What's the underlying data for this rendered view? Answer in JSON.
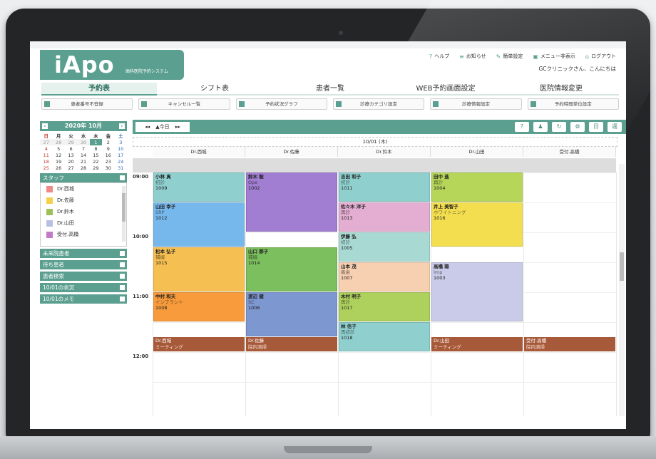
{
  "app": {
    "logo": "iApo",
    "subtitle": "歯科医院予約システム",
    "greeting": "GCクリニックさん、こんにちは"
  },
  "top_links": [
    {
      "icon": "?",
      "label": "ヘルプ"
    },
    {
      "icon": "≡",
      "label": "お知らせ"
    },
    {
      "icon": "✎",
      "label": "簡単設定"
    },
    {
      "icon": "▣",
      "label": "メニュー非表示"
    },
    {
      "icon": "⌂",
      "label": "ログアウト"
    }
  ],
  "main_tabs": [
    "予約表",
    "シフト表",
    "患者一覧",
    "WEB予約画面設定",
    "医院情報変更"
  ],
  "sub_buttons": [
    "患者番号不登録",
    "キャンセル一覧",
    "予約状況グラフ",
    "診療カテゴリ設定",
    "診療情報設定",
    "予約時間単位設定"
  ],
  "calendar": {
    "title": "2020年 10月",
    "weekdays": [
      "日",
      "月",
      "火",
      "水",
      "木",
      "金",
      "土"
    ],
    "weeks": [
      [
        "27",
        "28",
        "29",
        "30",
        "1",
        "2",
        "3"
      ],
      [
        "4",
        "5",
        "6",
        "7",
        "8",
        "9",
        "10"
      ],
      [
        "11",
        "12",
        "13",
        "14",
        "15",
        "16",
        "17"
      ],
      [
        "18",
        "19",
        "20",
        "21",
        "22",
        "23",
        "24"
      ],
      [
        "25",
        "26",
        "27",
        "28",
        "29",
        "30",
        "31"
      ]
    ]
  },
  "staff_panel": {
    "title": "スタッフ",
    "items": [
      {
        "name": "Dr.西城",
        "color": "#ee8a88"
      },
      {
        "name": "Dr.佐藤",
        "color": "#f3d24a"
      },
      {
        "name": "Dr.鈴木",
        "color": "#9cc15a"
      },
      {
        "name": "Dr.山田",
        "color": "#b7bfe6"
      },
      {
        "name": "受付.高橋",
        "color": "#c37ac7"
      }
    ]
  },
  "side_panels": [
    "未来院患者",
    "待ち患者",
    "患者検索",
    "10/01の状況",
    "10/01のメモ"
  ],
  "toolbar": {
    "prev": "◂◂",
    "today": "▲今日",
    "next": "▸▸",
    "day": "日",
    "week": "週"
  },
  "schedule": {
    "date": "10/01 (木)",
    "columns": [
      "Dr.西城",
      "Dr.佐藤",
      "Dr.鈴木",
      "Dr.山田",
      "受付.高橋"
    ],
    "times": [
      "09:00",
      "10:00",
      "11:00",
      "12:00"
    ],
    "appointments": [
      {
        "col": 0,
        "start": 0,
        "dur": 0.5,
        "name": "小林 真",
        "type": "初診",
        "id": "1009",
        "color": "#8fd0cf"
      },
      {
        "col": 0,
        "start": 0.5,
        "dur": 0.75,
        "name": "山田 幸子",
        "type": "SRP",
        "id": "1012",
        "color": "#76b7ec"
      },
      {
        "col": 0,
        "start": 1.25,
        "dur": 0.75,
        "name": "松本 弘子",
        "type": "補綴",
        "id": "1015",
        "color": "#f5bf52"
      },
      {
        "col": 0,
        "start": 2.0,
        "dur": 0.5,
        "name": "中村 和夫",
        "type": "インプラント",
        "id": "1008",
        "color": "#f79b3c"
      },
      {
        "col": 1,
        "start": 0,
        "dur": 1.0,
        "name": "鈴木 聡",
        "type": "Ope",
        "id": "1002",
        "color": "#a17ed1"
      },
      {
        "col": 1,
        "start": 1.25,
        "dur": 0.75,
        "name": "山口 節子",
        "type": "補綴",
        "id": "1014",
        "color": "#7cbf5e"
      },
      {
        "col": 1,
        "start": 2.0,
        "dur": 0.75,
        "name": "渡辺 健",
        "type": "SC",
        "id": "1006",
        "color": "#7d97d0"
      },
      {
        "col": 2,
        "start": 0,
        "dur": 0.5,
        "name": "吉田 和子",
        "type": "初診",
        "id": "1011",
        "color": "#8fd0cf"
      },
      {
        "col": 2,
        "start": 0.5,
        "dur": 0.5,
        "name": "佐々木 洋子",
        "type": "再診",
        "id": "1013",
        "color": "#e3aed1"
      },
      {
        "col": 2,
        "start": 1.0,
        "dur": 0.5,
        "name": "伊藤 弘",
        "type": "初診",
        "id": "1005",
        "color": "#a8d9d3"
      },
      {
        "col": 2,
        "start": 1.5,
        "dur": 0.5,
        "name": "山本 茂",
        "type": "義歯",
        "id": "1007",
        "color": "#f7cfb1"
      },
      {
        "col": 2,
        "start": 2.0,
        "dur": 0.5,
        "name": "木村 明子",
        "type": "再診",
        "id": "1017",
        "color": "#aed05d"
      },
      {
        "col": 2,
        "start": 2.5,
        "dur": 0.5,
        "name": "林 信子",
        "type": "再初診",
        "id": "1018",
        "color": "#8fd0cf"
      },
      {
        "col": 3,
        "start": 0,
        "dur": 0.5,
        "name": "田中 進",
        "type": "再診",
        "id": "1004",
        "color": "#b6d65a"
      },
      {
        "col": 3,
        "start": 0.5,
        "dur": 0.75,
        "name": "井上 美智子",
        "type": "ホワイトニング",
        "id": "1016",
        "color": "#f3de50"
      },
      {
        "col": 3,
        "start": 1.5,
        "dur": 1.0,
        "name": "高橋 陽",
        "type": "Imp",
        "id": "1003",
        "color": "#c9cbe8"
      }
    ],
    "meetings": [
      {
        "col": 0,
        "staff": "Dr.西城",
        "desc": "ミーティング"
      },
      {
        "col": 1,
        "staff": "Dr.佐藤",
        "desc": "院内清掃"
      },
      {
        "col": 3,
        "staff": "Dr.山田",
        "desc": "ミーティング"
      },
      {
        "col": 4,
        "staff": "受付.高橋",
        "desc": "院内清掃"
      }
    ]
  }
}
